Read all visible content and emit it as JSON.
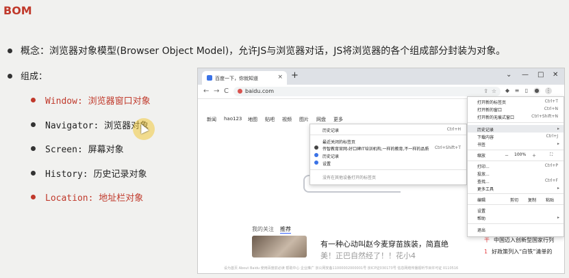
{
  "slide": {
    "title": "BOM",
    "concept": "概念：浏览器对象模型(Browser Object Model)，允许JS与浏览器对话，JS将浏览器的各个组成部分封装为对象。",
    "composition_label": "组成：",
    "items": [
      {
        "label": "Window: 浏览器窗口对象",
        "highlight": true
      },
      {
        "label": "Navigator: 浏览器对象",
        "highlight": false
      },
      {
        "label": "Screen: 屏幕对象",
        "highlight": false
      },
      {
        "label": "History: 历史记录对象",
        "highlight": false
      },
      {
        "label": "Location: 地址栏对象",
        "highlight": true
      }
    ]
  },
  "browser": {
    "tab_title": "百度一下，你就知道",
    "tab_close": "×",
    "new_tab": "+",
    "window_controls": {
      "down": "⌄",
      "min": "—",
      "max": "□",
      "close": "✕"
    },
    "nav": {
      "back": "←",
      "forward": "→",
      "reload": "C"
    },
    "url": "baidu.com",
    "nav_links": [
      "新闻",
      "hao123",
      "地图",
      "贴吧",
      "视频",
      "图片",
      "网盘",
      "更多"
    ],
    "feed_tabs": [
      "我的关注",
      "推荐"
    ],
    "news": {
      "title": "有一种心动叫赵今麦穿苗族装，简直绝",
      "subtitle": "美！正巴自然经了！！花小4"
    },
    "hot_list": [
      {
        "n": "干",
        "text": "中国迈入创新型国家行列"
      },
      {
        "n": "1",
        "text": "好政策列入“白铁”清单的"
      }
    ],
    "footer": "设为首页   About Baidu   使用百度前必读   帮助中心   企业推广   京公网安备11000002000001号   京ICP证030173号   信息网络传播视听节目许可证 0110516"
  },
  "chrome_menu": {
    "items": [
      {
        "label": "打开新的标签页",
        "shortcut": "Ctrl+T"
      },
      {
        "label": "打开新的窗口",
        "shortcut": "Ctrl+N"
      },
      {
        "label": "打开新的无痕式窗口",
        "shortcut": "Ctrl+Shift+N"
      },
      {
        "label": "历史记录",
        "shortcut": "▸"
      },
      {
        "label": "下载内容",
        "shortcut": "Ctrl+J"
      },
      {
        "label": "书签",
        "shortcut": "▸"
      },
      {
        "label": "缩放",
        "shortcut": ""
      },
      {
        "label": "打印...",
        "shortcut": "Ctrl+P"
      },
      {
        "label": "投放...",
        "shortcut": ""
      },
      {
        "label": "查找...",
        "shortcut": "Ctrl+F"
      },
      {
        "label": "更多工具",
        "shortcut": "▸"
      },
      {
        "label": "编辑",
        "shortcut": ""
      },
      {
        "label": "设置",
        "shortcut": ""
      },
      {
        "label": "帮助",
        "shortcut": "▸"
      },
      {
        "label": "退出",
        "shortcut": ""
      }
    ],
    "zoom": {
      "minus": "－",
      "value": "100%",
      "plus": "＋",
      "full": "⛶"
    },
    "edit": {
      "cut": "剪切",
      "copy": "复制",
      "paste": "粘贴"
    }
  },
  "history_menu": {
    "header": "历史记录",
    "header_shortcut": "Ctrl+H",
    "recent_label": "最近关闭的标签页",
    "entries": [
      {
        "label": "传智教育官网-好口碑IT培训机构,一样的教育,不一样的品质",
        "shortcut": "Ctrl+Shift+T"
      },
      {
        "label": "历史记录",
        "shortcut": ""
      },
      {
        "label": "设置",
        "shortcut": ""
      }
    ],
    "footer": "没有在其他设备打开的标签页"
  },
  "colors": {
    "accent_red": "#c0392b",
    "omnibox_lock": "#d9534f",
    "favicon_blue": "#3a72e6"
  }
}
